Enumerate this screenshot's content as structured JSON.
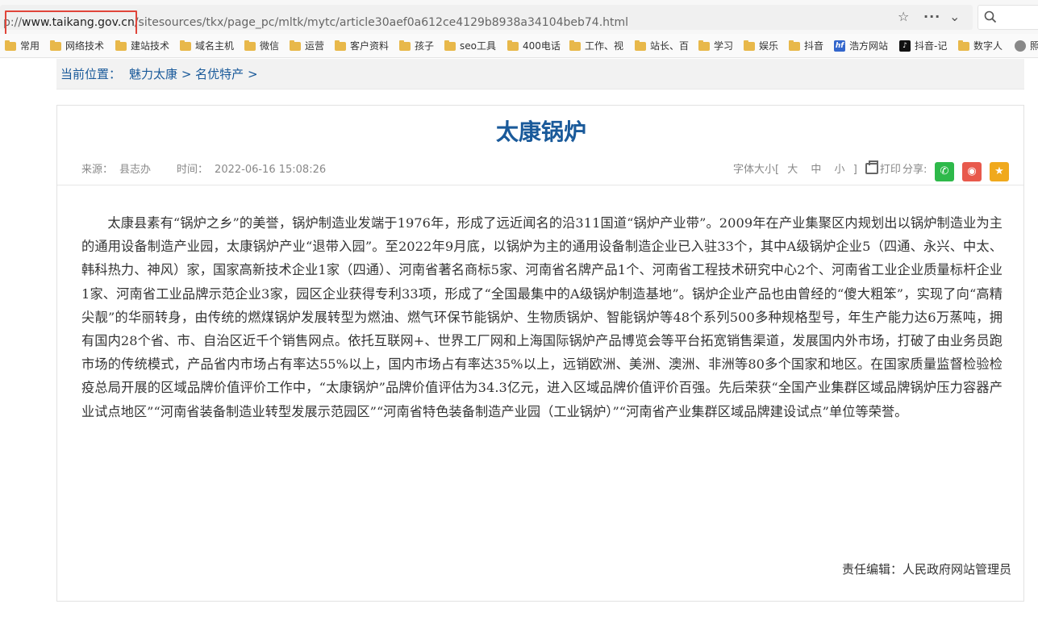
{
  "browser": {
    "url_prefix": "p://",
    "url_host": "www.taikang.gov.cn",
    "url_path": "/sitesources/tkx/page_pc/mltk/mytc/article30aef0a612ce4129b8938a34104beb74.html",
    "icons": [
      "star-icon",
      "more-icon",
      "chevron-down-icon",
      "search-icon"
    ]
  },
  "bookmarks": [
    {
      "label": "常用",
      "icon": "folder-icon"
    },
    {
      "label": "网络技术",
      "icon": "folder-icon"
    },
    {
      "label": "建站技术",
      "icon": "folder-icon"
    },
    {
      "label": "域名主机",
      "icon": "folder-icon"
    },
    {
      "label": "微信",
      "icon": "folder-icon"
    },
    {
      "label": "运营",
      "icon": "folder-icon"
    },
    {
      "label": "客户资料",
      "icon": "folder-icon"
    },
    {
      "label": "孩子",
      "icon": "folder-icon"
    },
    {
      "label": "seo工具",
      "icon": "folder-icon"
    },
    {
      "label": "400电话",
      "icon": "folder-icon"
    },
    {
      "label": "工作、视",
      "icon": "folder-icon"
    },
    {
      "label": "站长、百",
      "icon": "folder-icon"
    },
    {
      "label": "学习",
      "icon": "folder-icon"
    },
    {
      "label": "娱乐",
      "icon": "folder-icon"
    },
    {
      "label": "抖音",
      "icon": "folder-icon"
    },
    {
      "label": "浩方网站",
      "icon": "hf-icon"
    },
    {
      "label": "抖音-记",
      "icon": "tiktok-icon"
    },
    {
      "label": "数字人",
      "icon": "folder-icon"
    },
    {
      "label": "照",
      "icon": "globe-icon"
    }
  ],
  "breadcrumb": {
    "prefix": "当前位置：",
    "item1": "魅力太康",
    "sep1": ">",
    "item2": "名优特产",
    "sep2": ">"
  },
  "article": {
    "title": "太康锅炉",
    "source_label": "来源：",
    "source": "县志办",
    "time_label": "时间：",
    "time": "2022-06-16 15:08:26",
    "font_size_label": "字体大小[",
    "size_large": "大",
    "size_medium": "中",
    "size_small": "小",
    "font_size_close": "]",
    "print_label": "打印",
    "share_label": "分享:",
    "body": "太康县素有“锅炉之乡”的美誉，锅炉制造业发端于1976年，形成了远近闻名的沿311国道“锅炉产业带”。2009年在产业集聚区内规划出以锅炉制造业为主的通用设备制造产业园，太康锅炉产业“退带入园”。至2022年9月底，以锅炉为主的通用设备制造企业已入驻33个，其中A级锅炉企业5（四通、永兴、中太、韩科热力、神风）家，国家高新技术企业1家（四通）、河南省著名商标5家、河南省名牌产品1个、河南省工程技术研究中心2个、河南省工业企业质量标杆企业1家、河南省工业品牌示范企业3家，园区企业获得专利33项，形成了“全国最集中的A级锅炉制造基地”。锅炉企业产品也由曾经的“傻大粗笨”，实现了向“高精尖靓”的华丽转身，由传统的燃煤锅炉发展转型为燃油、燃气环保节能锅炉、生物质锅炉、智能锅炉等48个系列500多种规格型号，年生产能力达6万蒸吨，拥有国内28个省、市、自治区近千个销售网点。依托互联网+、世界工厂网和上海国际锅炉产品博览会等平台拓宽销售渠道，发展国内外市场，打破了由业务员跑市场的传统模式，产品省内市场占有率达55%以上，国内市场占有率达35%以上，远销欧洲、美洲、澳洲、非洲等80多个国家和地区。在国家质量监督检验检疫总局开展的区域品牌价值评价工作中，“太康锅炉”品牌价值评估为34.3亿元，进入区域品牌价值评价百强。先后荣获“全国产业集群区域品牌锅炉压力容器产业试点地区”“河南省装备制造业转型发展示范园区”“河南省特色装备制造产业园（工业锅炉）”“河南省产业集群区域品牌建设试点”单位等荣誉。",
    "editor": "责任编辑：人民政府网站管理员"
  },
  "colors": {
    "accent": "#1a5a9a",
    "highlight_box": "#e0453a",
    "wechat": "#2eb94a",
    "weibo": "#e8594c",
    "favorite": "#f0a91d"
  }
}
